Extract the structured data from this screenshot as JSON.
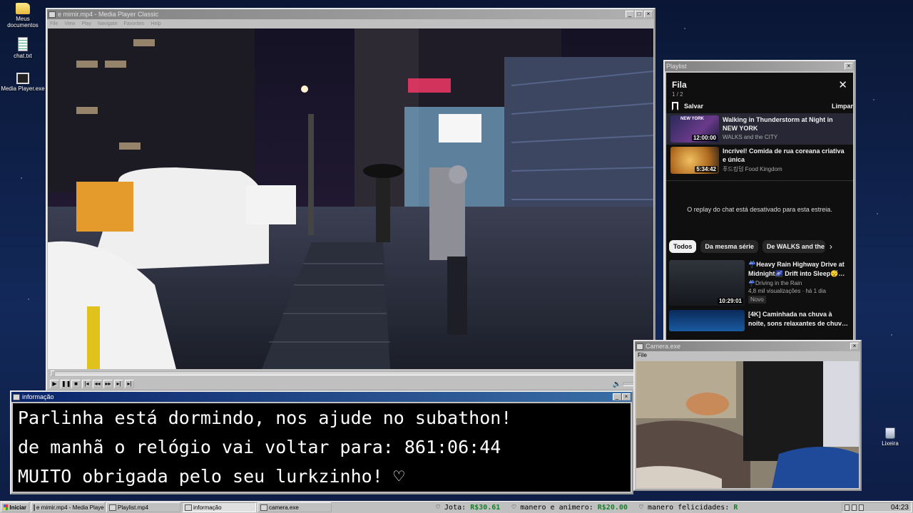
{
  "desktop": {
    "icons": [
      {
        "label": "Meus documentos",
        "icon": "folder-icon"
      },
      {
        "label": "chat.txt",
        "icon": "text-file-icon"
      },
      {
        "label": "Media Player.exe",
        "icon": "media-player-icon"
      }
    ],
    "trash_label": "Lixeira"
  },
  "player": {
    "title": "e mimir.mp4 - Media Player Classic",
    "menu": [
      "File",
      "View",
      "Play",
      "Navigate",
      "Favorites",
      "Help"
    ]
  },
  "playlist": {
    "window_title": "Playlist",
    "heading": "Fila",
    "count": "1 / 2",
    "save_label": "Salvar",
    "clear_label": "Limpar",
    "queue": [
      {
        "title": "Walking in Thunderstorm at Night in NEW YORK",
        "channel": "WALKS and the CITY",
        "duration": "12:00:00",
        "thumb_caption": "NEW YORK"
      },
      {
        "title": "Incrível! Comida de rua coreana criativa e única",
        "channel": "푸드킹덤 Food Kingdom",
        "duration": "5:34:42"
      }
    ],
    "chat_notice": "O replay do chat está desativado para esta estreia.",
    "chips": [
      "Todos",
      "Da mesma série",
      "De WALKS and the C"
    ],
    "recs": [
      {
        "title": "☔Heavy Rain Highway Drive at Midnight🌌 Drift into Sleep😴…",
        "channel": "☔Driving in the Rain",
        "meta": "4,8 mil visualizações · há 1 dia",
        "badge": "Novo",
        "duration": "10:29:01"
      },
      {
        "title": "[4K] Caminhada na chuva à noite, sons relaxantes de chuv…"
      }
    ]
  },
  "camera": {
    "title": "Camera.exe",
    "menu": "File"
  },
  "info": {
    "title": "informação",
    "lines": [
      "Parlinha está dormindo, nos ajude no subathon!",
      "de manhã o relógio vai voltar para:  861:06:44",
      "MUITO obrigada pelo seu lurkzinho! ♡"
    ]
  },
  "taskbar": {
    "start": "Iniciar",
    "items": [
      {
        "label": "e mimir.mp4 - Media Playe...",
        "active": false
      },
      {
        "label": "Playlist.mp4",
        "active": false
      },
      {
        "label": "informação",
        "active": true
      },
      {
        "label": "camera.exe",
        "active": false
      }
    ],
    "ticker": [
      {
        "label": "♡ Jota:",
        "amount": "R$30.61"
      },
      {
        "label": "♡ manero e animero:",
        "amount": "R$20.00"
      },
      {
        "label": "♡ manero felicidades:",
        "amount": "R"
      }
    ],
    "clock": "04:23"
  },
  "colors": {
    "titlebar": "#0a246a",
    "window": "#c0c0c0",
    "amount": "#1a7f2a",
    "desktop": "#0b1a3a"
  }
}
